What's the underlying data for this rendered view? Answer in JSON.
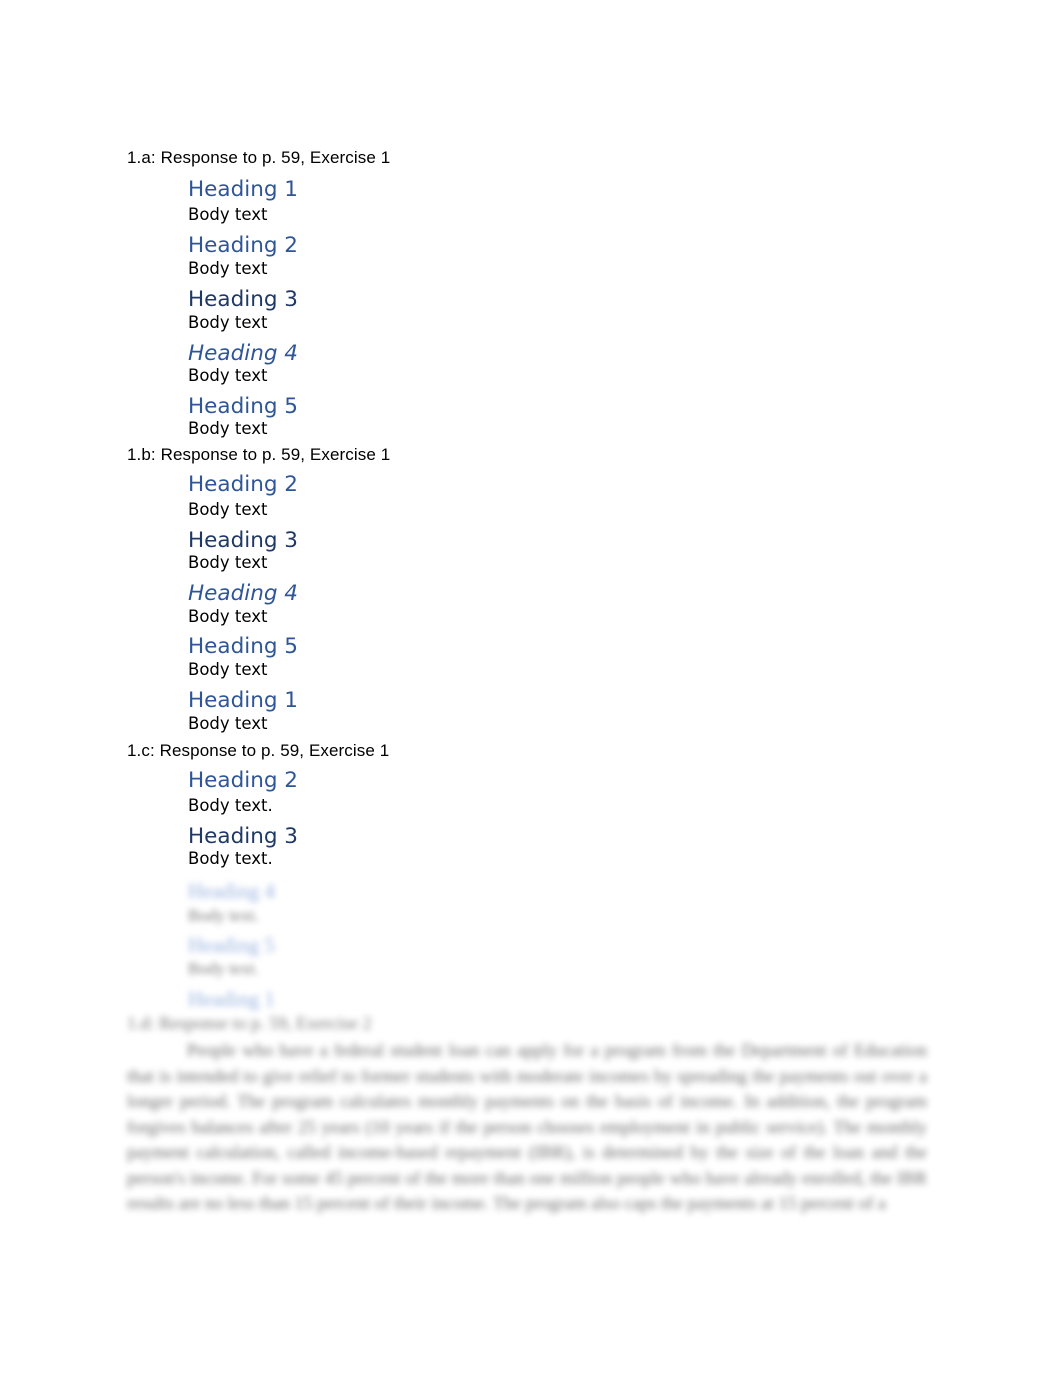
{
  "document": {
    "sections": [
      {
        "label": "1.a: Response to p. 59, Exercise 1",
        "items": [
          {
            "heading": "Heading 1",
            "level": 1,
            "body": "Body text"
          },
          {
            "heading": "Heading 2",
            "level": 2,
            "body": "Body text"
          },
          {
            "heading": "Heading 3",
            "level": 3,
            "body": "Body text"
          },
          {
            "heading": "Heading 4",
            "level": 4,
            "body": "Body text"
          },
          {
            "heading": "Heading 5",
            "level": 5,
            "body": "Body text"
          }
        ]
      },
      {
        "label": "1.b: Response to p. 59, Exercise 1",
        "items": [
          {
            "heading": "Heading 2",
            "level": 2,
            "body": "Body text"
          },
          {
            "heading": "Heading 3",
            "level": 3,
            "body": "Body text"
          },
          {
            "heading": "Heading 4",
            "level": 4,
            "body": "Body text"
          },
          {
            "heading": "Heading 5",
            "level": 5,
            "body": "Body text"
          },
          {
            "heading": "Heading 1",
            "level": 1,
            "body": "Body text"
          }
        ]
      },
      {
        "label": "1.c: Response to p. 59, Exercise 1",
        "items": [
          {
            "heading": "Heading 2",
            "level": 2,
            "body": "Body text."
          },
          {
            "heading": "Heading 3",
            "level": 3,
            "body": "Body text."
          }
        ]
      }
    ],
    "blurred_preview": {
      "items": [
        {
          "heading": "Heading 4",
          "body": "Body text."
        },
        {
          "heading": "Heading 5",
          "body": "Body text."
        },
        {
          "heading": "Heading 1",
          "body": ""
        }
      ],
      "label": "1.d: Response to p. 59, Exercise 2",
      "paragraph": "People who have a federal student loan can apply for a program from the Department of Education that is intended to give relief to former students with moderate incomes by spreading the payments out over a longer period. The program calculates monthly payments on the basis of income. In addition, the program forgives balances after 25 years (10 years if the person chooses employment in public service). The monthly payment calculation, called income-based repayment (IBR), is determined by the size of the loan and the person's income. For some 45 percent of the more than one million people who have already enrolled, the IBR results are no less than 15 percent of their income. The program also caps the payments at 15 percent of a"
    }
  },
  "colors": {
    "heading": "#2f5597",
    "heading3": "#1f3864",
    "body": "#000000"
  }
}
